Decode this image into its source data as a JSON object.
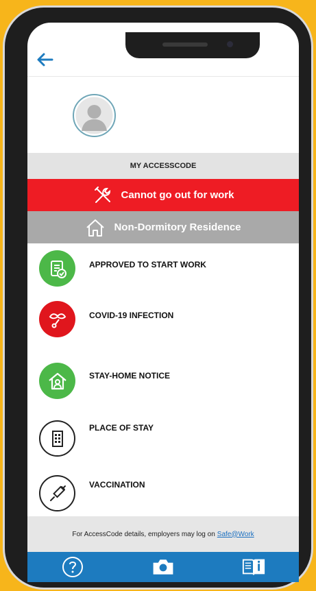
{
  "header": {
    "back_icon": "arrow-left-icon"
  },
  "profile": {
    "avatar_icon": "user-avatar-icon"
  },
  "accesscode": {
    "title": "MY ACCESSCODE",
    "work_status": {
      "text": "Cannot go out for work",
      "icon": "tools-cross-icon",
      "color": "#ee1c24"
    },
    "residence": {
      "text": "Non-Dormitory Residence",
      "icon": "house-icon",
      "color": "#a9a9a9"
    }
  },
  "items": [
    {
      "label": "APPROVED TO START WORK",
      "icon": "approved-document-icon",
      "color": "#4cb848"
    },
    {
      "label": "COVID-19 INFECTION",
      "icon": "virus-infection-icon",
      "color": "#e0161d"
    },
    {
      "label": "STAY-HOME NOTICE",
      "icon": "home-notice-icon",
      "color": "#4cb848"
    },
    {
      "label": "PLACE OF STAY",
      "icon": "building-icon",
      "color": "#ffffff"
    },
    {
      "label": "VACCINATION",
      "icon": "syringe-icon",
      "color": "#ffffff"
    }
  ],
  "footer": {
    "note": "For AccessCode details, employers may log on",
    "link": "Safe@Work"
  },
  "bottom_nav": {
    "help_icon": "help-icon",
    "camera_icon": "camera-icon",
    "info_icon": "info-book-icon"
  }
}
